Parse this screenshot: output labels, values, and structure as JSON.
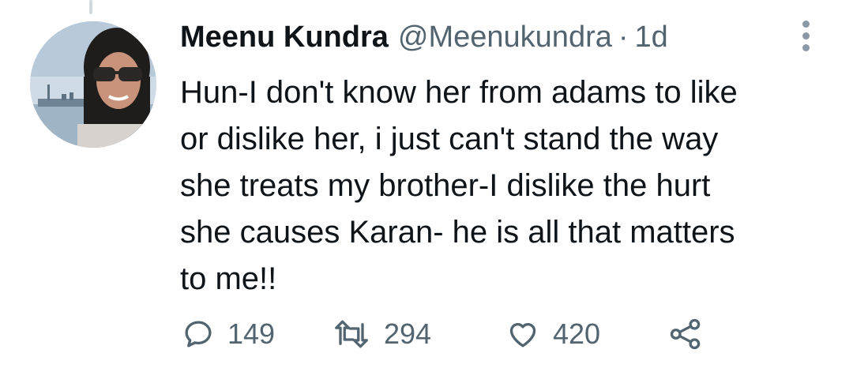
{
  "tweet": {
    "author_name": "Meenu Kundra",
    "author_handle": "@Meenukundra",
    "separator": "·",
    "time": "1d",
    "text": "Hun-I don't know her from adams to like\nor dislike her, i just can't stand the way\nshe treats my brother-I dislike the hurt\nshe causes Karan- he is all that matters\nto me!!",
    "replies": "149",
    "retweets": "294",
    "likes": "420"
  },
  "icons": {
    "more": "more-options-icon",
    "reply": "reply-icon",
    "retweet": "retweet-icon",
    "like": "heart-icon",
    "share": "share-icon"
  },
  "colors": {
    "text": "#0f1419",
    "secondary": "#536471",
    "thread_line": "#cfd9de"
  }
}
